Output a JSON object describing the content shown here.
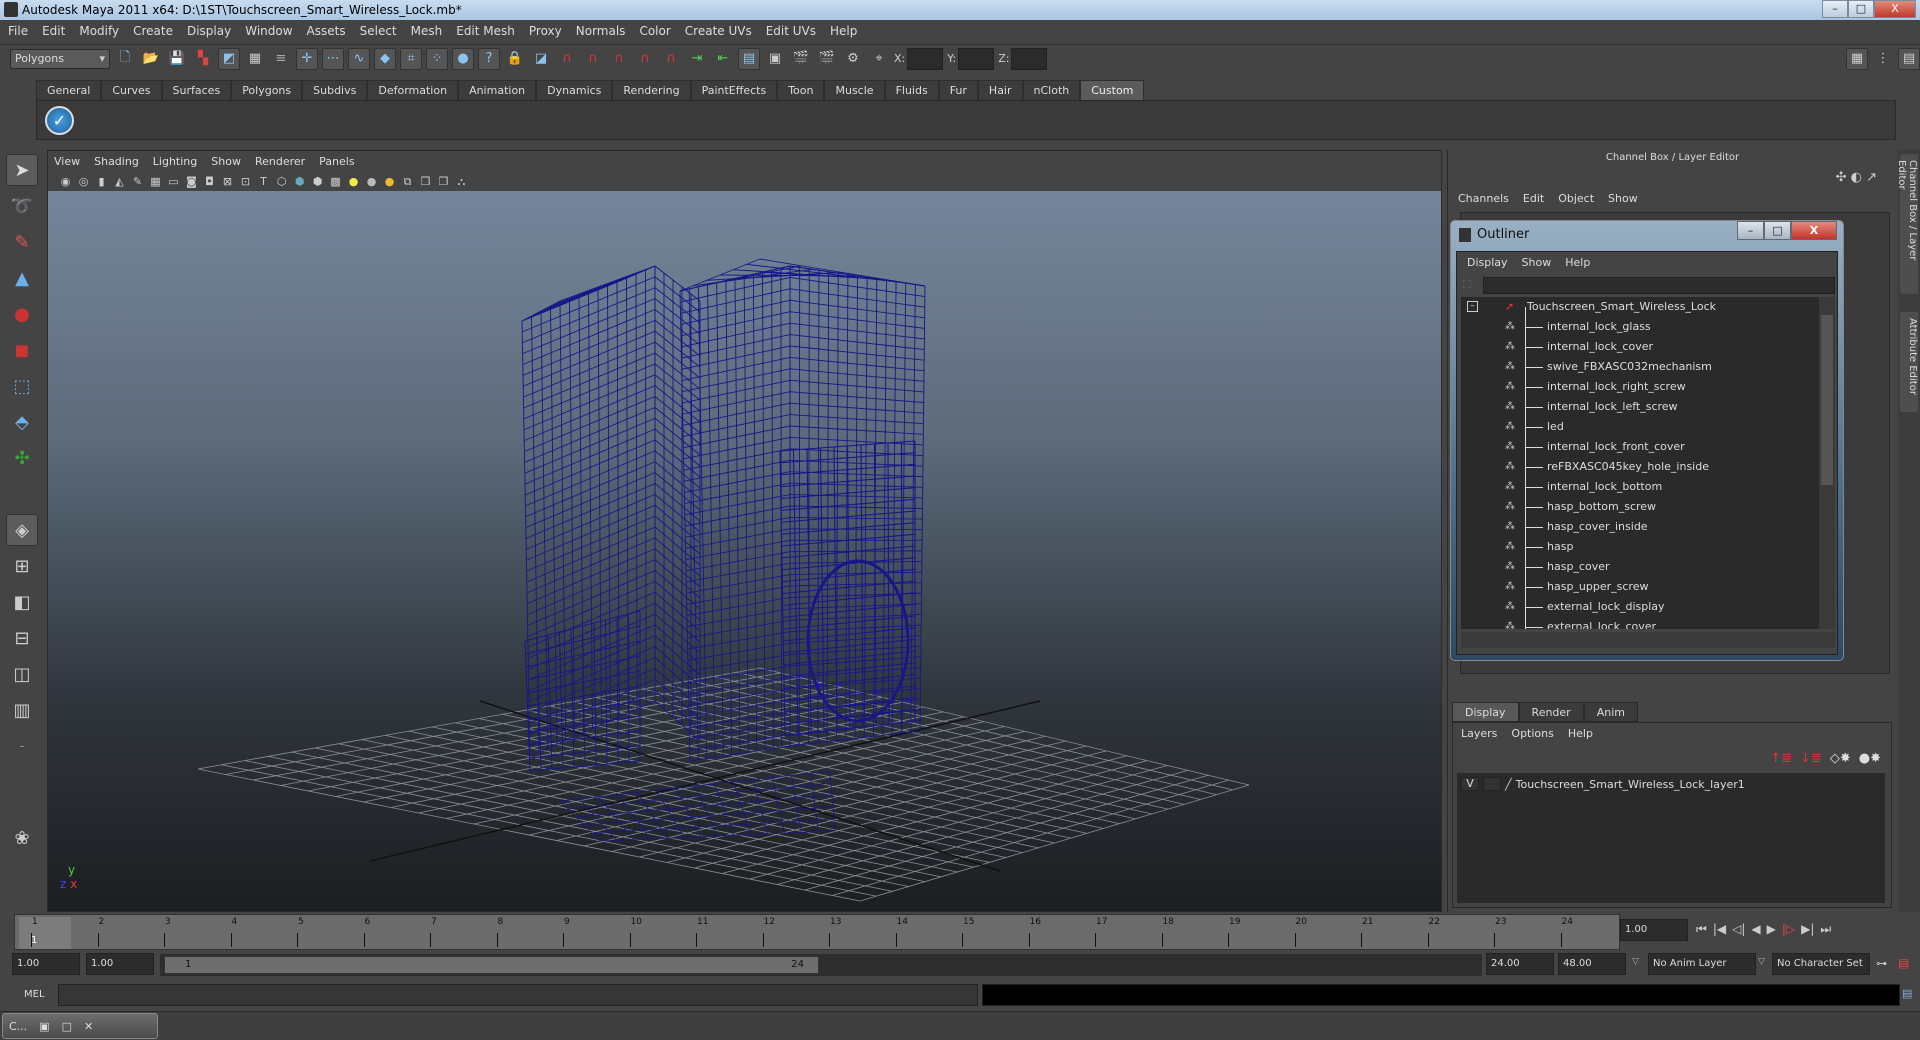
{
  "window": {
    "title": "Autodesk Maya 2011 x64: D:\\1ST\\Touchscreen_Smart_Wireless_Lock.mb*",
    "minimize": "–",
    "maximize": "□",
    "close": "X"
  },
  "menubar": [
    "File",
    "Edit",
    "Modify",
    "Create",
    "Display",
    "Window",
    "Assets",
    "Select",
    "Mesh",
    "Edit Mesh",
    "Proxy",
    "Normals",
    "Color",
    "Create UVs",
    "Edit UVs",
    "Help"
  ],
  "toolbar": {
    "mode": "Polygons",
    "x_label": "X:",
    "y_label": "Y:",
    "z_label": "Z:"
  },
  "shelf": {
    "tabs": [
      "General",
      "Curves",
      "Surfaces",
      "Polygons",
      "Subdivs",
      "Deformation",
      "Animation",
      "Dynamics",
      "Rendering",
      "PaintEffects",
      "Toon",
      "Muscle",
      "Fluids",
      "Fur",
      "Hair",
      "nCloth",
      "Custom"
    ],
    "active": "Custom"
  },
  "viewport": {
    "menu": [
      "View",
      "Shading",
      "Lighting",
      "Show",
      "Renderer",
      "Panels"
    ],
    "axis_y": "y",
    "axis_x": "x",
    "axis_z": "z",
    "wire_color": "#17178a"
  },
  "channel_box": {
    "header": "Channel Box / Layer Editor",
    "menu": [
      "Channels",
      "Edit",
      "Object",
      "Show"
    ]
  },
  "outliner": {
    "title": "Outliner",
    "menu": [
      "Display",
      "Show",
      "Help"
    ],
    "root": "Touchscreen_Smart_Wireless_Lock",
    "items": [
      "internal_lock_glass",
      "internal_lock_cover",
      "swive_FBXASC032mechanism",
      "internal_lock_right_screw",
      "internal_lock_left_screw",
      "led",
      "internal_lock_front_cover",
      "reFBXASC045key_hole_inside",
      "internal_lock_bottom",
      "hasp_bottom_screw",
      "hasp_cover_inside",
      "hasp",
      "hasp_cover",
      "hasp_upper_screw",
      "external_lock_display",
      "external_lock_cover"
    ]
  },
  "layer_editor": {
    "tabs": [
      "Display",
      "Render",
      "Anim"
    ],
    "active": "Display",
    "menu": [
      "Layers",
      "Options",
      "Help"
    ],
    "layer": {
      "visible": "V",
      "name": "Touchscreen_Smart_Wireless_Lock_layer1"
    }
  },
  "side_tabs": [
    "Channel Box / Layer Editor",
    "Attribute Editor"
  ],
  "timeline": {
    "frames": [
      "1",
      "2",
      "3",
      "4",
      "5",
      "6",
      "7",
      "8",
      "9",
      "10",
      "11",
      "12",
      "13",
      "14",
      "15",
      "16",
      "17",
      "18",
      "19",
      "20",
      "21",
      "22",
      "23",
      "24"
    ],
    "current": "1",
    "current_field": "1.00"
  },
  "range": {
    "start": "1.00",
    "playback_start": "1.00",
    "slider_start": "1",
    "slider_end": "24",
    "playback_end": "24.00",
    "end": "48.00",
    "anim_layer": "No Anim Layer",
    "character_set": "No Character Set"
  },
  "mel": {
    "label": "MEL"
  },
  "taskbar": {
    "item": "C..."
  }
}
